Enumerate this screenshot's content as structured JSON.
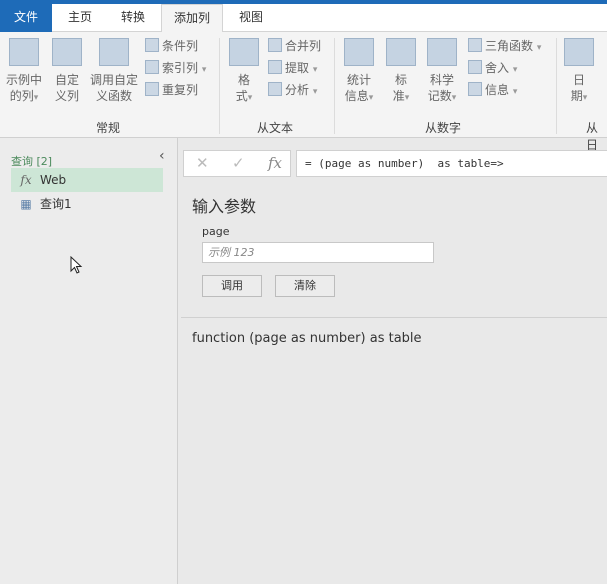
{
  "tabs": [
    "文件",
    "主页",
    "转换",
    "添加列",
    "视图"
  ],
  "ribbon": {
    "general": {
      "label": "常规",
      "col_from_examples": "示例中的列",
      "col_from_examples_l1": "示例中",
      "col_from_examples_l2": "的列",
      "custom_col_l1": "自定",
      "custom_col_l2": "义列",
      "invoke_fn_l1": "调用自定",
      "invoke_fn_l2": "义函数",
      "conditional": "条件列",
      "index": "索引列",
      "duplicate": "重复列"
    },
    "text": {
      "label": "从文本",
      "format_l1": "格",
      "format_l2": "式",
      "merge": "合并列",
      "extract": "提取",
      "parse": "分析"
    },
    "number": {
      "label": "从数字",
      "stats_l1": "统计",
      "stats_l2": "信息",
      "standard_l1": "标",
      "standard_l2": "准",
      "sci_l1": "科学",
      "sci_l2": "记数",
      "trig": "三角函数",
      "round": "舍入",
      "info": "信息"
    },
    "date": {
      "label": "从日",
      "date_l1": "日",
      "date_l2": "期"
    }
  },
  "sidebar": {
    "header": "查询 [2]",
    "items": [
      {
        "label": "Web",
        "icon": "fx-icon"
      },
      {
        "label": "查询1",
        "icon": "table-icon"
      }
    ]
  },
  "formula": "= (page as number)  as table=>",
  "main": {
    "title": "输入参数",
    "param_label": "page",
    "param_placeholder": "示例 123",
    "invoke": "调用",
    "clear": "清除",
    "signature": "function (page as number) as table"
  },
  "colors": {
    "accent": "#1e6bb8",
    "selected": "#cde6d6"
  }
}
